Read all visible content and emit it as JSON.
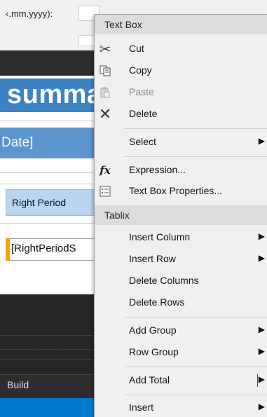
{
  "background": {
    "param_label": "‹.mm.yyyy):",
    "report_title_fragment": "summa",
    "date_fragment": "Date]",
    "column_header": "Right Period",
    "data_field": "[RightPeriodS",
    "build_label": "Build"
  },
  "context_menu": {
    "sections": [
      {
        "header": "Text Box",
        "items": [
          {
            "label": "Cut",
            "icon": "scissors-icon",
            "enabled": true
          },
          {
            "label": "Copy",
            "icon": "copy-icon",
            "enabled": true
          },
          {
            "label": "Paste",
            "icon": "paste-icon",
            "enabled": false
          },
          {
            "label": "Delete",
            "icon": "delete-x-icon",
            "enabled": true
          },
          {
            "label": "Select",
            "submenu": true
          },
          {
            "label": "Expression...",
            "icon": "fx-icon"
          },
          {
            "label": "Text Box Properties...",
            "icon": "properties-icon"
          }
        ]
      },
      {
        "header": "Tablix",
        "items": [
          {
            "label": "Insert Column",
            "submenu": true
          },
          {
            "label": "Insert Row",
            "submenu": true
          },
          {
            "label": "Delete Columns"
          },
          {
            "label": "Delete Rows"
          },
          {
            "label": "Add Group",
            "submenu": true
          },
          {
            "label": "Row Group",
            "submenu": true
          },
          {
            "label": "Add Total",
            "submenu": true,
            "split": true
          },
          {
            "label": "Insert",
            "submenu": true
          }
        ]
      }
    ]
  },
  "colors": {
    "accent_blue": "#3d83c3",
    "header_blue": "#b8d4ef",
    "status_bar": "#007acc",
    "menu_bg": "#f0f0f0",
    "disabled_text": "#8d8d8d"
  }
}
